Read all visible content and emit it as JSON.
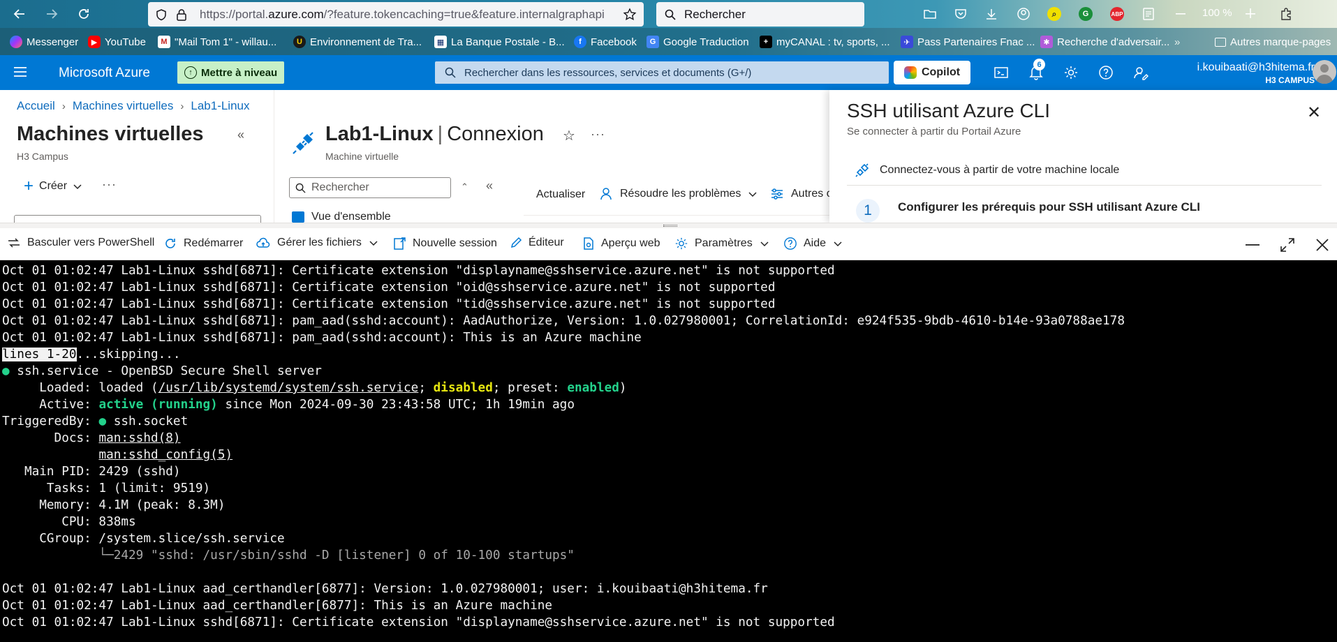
{
  "browser": {
    "url_prefix": "https://portal.",
    "url_domain": "azure.com",
    "url_rest": "/?feature.tokencaching=true&feature.internalgraphapi",
    "search_placeholder": "Rechercher",
    "zoom": "100 %",
    "bookmarks": [
      "Messenger",
      "YouTube",
      "\"Mail Tom 1\" - willau...",
      "Environnement de Tra...",
      "La Banque Postale - B...",
      "Facebook",
      "Google Traduction",
      "myCANAL : tv, sports, ...",
      "Pass Partenaires Fnac ...",
      "Recherche d'adversair...",
      "Autres marque-pages"
    ]
  },
  "azure": {
    "brand": "Microsoft Azure",
    "upgrade_label": "Mettre à niveau",
    "search_placeholder": "Rechercher dans les ressources, services et documents (G+/)",
    "copilot_label": "Copilot",
    "notification_count": "6",
    "user_email": "i.kouibaati@h3hitema.fr",
    "user_tenant": "H3 CAMPUS"
  },
  "breadcrumb": [
    "Accueil",
    "Machines virtuelles",
    "Lab1-Linux"
  ],
  "left_blade": {
    "title": "Machines virtuelles",
    "subtitle": "H3 Campus",
    "create_label": "Créer"
  },
  "vm_blade": {
    "name": "Lab1-Linux",
    "section": "Connexion",
    "subtitle": "Machine virtuelle",
    "search_placeholder": "Rechercher",
    "nav_overview": "Vue d'ensemble",
    "cmd_refresh": "Actualiser",
    "cmd_troubleshoot": "Résoudre les problèmes",
    "cmd_other": "Autres o"
  },
  "ssh_panel": {
    "title": "SSH utilisant Azure CLI",
    "subtitle": "Se connecter à partir du Portail Azure",
    "local_label": "Connectez-vous à partir de votre machine locale",
    "step_number": "1",
    "step_title": "Configurer les prérequis pour SSH utilisant Azure CLI"
  },
  "shell_toolbar": {
    "switch_label": "Basculer vers PowerShell",
    "restart_label": "Redémarrer",
    "files_label": "Gérer les fichiers",
    "session_label": "Nouvelle session",
    "editor_label": "Éditeur",
    "webpreview_label": "Aperçu web",
    "settings_label": "Paramètres",
    "help_label": "Aide"
  },
  "terminal": {
    "l1": "Oct 01 01:02:47 Lab1-Linux sshd[6871]: Certificate extension \"displayname@sshservice.azure.net\" is not supported",
    "l2": "Oct 01 01:02:47 Lab1-Linux sshd[6871]: Certificate extension \"oid@sshservice.azure.net\" is not supported",
    "l3": "Oct 01 01:02:47 Lab1-Linux sshd[6871]: Certificate extension \"tid@sshservice.azure.net\" is not supported",
    "l4": "Oct 01 01:02:47 Lab1-Linux sshd[6871]: pam_aad(sshd:account): AadAuthorize, Version: 1.0.027980001; CorrelationId: e924f535-9bdb-4610-b14e-93a0788ae178",
    "l5": "Oct 01 01:02:47 Lab1-Linux sshd[6871]: pam_aad(sshd:account): This is an Azure machine",
    "l6_highlight": "lines 1-20",
    "l6_rest": "...skipping...",
    "l7_dot": "●",
    "l7": " ssh.service - OpenBSD Secure Shell server",
    "l8_a": "     Loaded: loaded (",
    "l8_path": "/usr/lib/systemd/system/ssh.service",
    "l8_b": "; ",
    "l8_disabled": "disabled",
    "l8_c": "; preset: ",
    "l8_enabled": "enabled",
    "l8_d": ")",
    "l9_a": "     Active: ",
    "l9_active": "active (running)",
    "l9_b": " since Mon 2024-09-30 23:43:58 UTC; 1h 19min ago",
    "l10_a": "TriggeredBy: ",
    "l10_dot": "●",
    "l10_b": " ssh.socket",
    "l11_a": "       Docs: ",
    "l11_doc": "man:sshd(8)",
    "l12_a": "             ",
    "l12_doc": "man:sshd_config(5)",
    "l13": "   Main PID: 2429 (sshd)",
    "l14": "      Tasks: 1 (limit: 9519)",
    "l15": "     Memory: 4.1M (peak: 8.3M)",
    "l16": "        CPU: 838ms",
    "l17": "     CGroup: /system.slice/ssh.service",
    "l18_a": "             ",
    "l18": "└─2429 \"sshd: /usr/sbin/sshd -D [listener] 0 of 10-100 startups\"",
    "l19": "",
    "l20": "Oct 01 01:02:47 Lab1-Linux aad_certhandler[6877]: Version: 1.0.027980001; user: i.kouibaati@h3hitema.fr",
    "l21": "Oct 01 01:02:47 Lab1-Linux aad_certhandler[6877]: This is an Azure machine",
    "l22": "Oct 01 01:02:47 Lab1-Linux sshd[6871]: Certificate extension \"displayname@sshservice.azure.net\" is not supported"
  }
}
